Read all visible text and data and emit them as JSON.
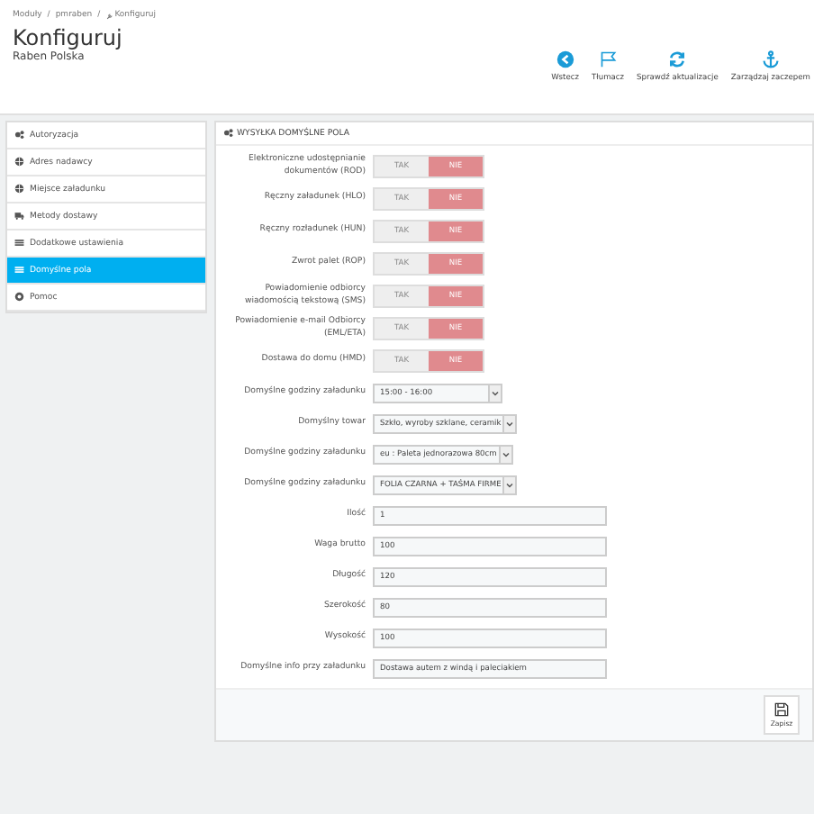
{
  "breadcrumb": [
    {
      "kind": "link",
      "text": "Moduły"
    },
    {
      "kind": "separator",
      "text": "/"
    },
    {
      "kind": "link",
      "text": "pmraben"
    },
    {
      "kind": "separator",
      "text": "/"
    },
    {
      "kind": "current",
      "text": "Konfiguruj"
    }
  ],
  "page_title": "Konfiguruj",
  "page_subtitle": "Raben Polska",
  "toolbar": [
    {
      "label": "Wstecz"
    },
    {
      "label": "Tłumacz"
    },
    {
      "label": "Sprawdź aktualizacje"
    },
    {
      "label": "Zarządzaj zaczepem"
    }
  ],
  "sidebar": {
    "items": [
      {
        "label": "Autoryzacja",
        "selected": false
      },
      {
        "label": "Adres nadawcy",
        "selected": false
      },
      {
        "label": "Miejsce załadunku",
        "selected": false
      },
      {
        "label": "Metody dostawy",
        "selected": false
      },
      {
        "label": "Dodatkowe ustawienia",
        "selected": false
      },
      {
        "label": "Domyślne pola",
        "selected": true
      },
      {
        "label": "Pomoc",
        "selected": false
      }
    ]
  },
  "panel": {
    "title": "WYSYŁKA DOMYŚLNE POLA",
    "fields": [
      {
        "kind": "toggle",
        "label": "Elektroniczne udostępnianie dokumentów (ROD)",
        "yes": "TAK",
        "no": "NIE",
        "on": false
      },
      {
        "kind": "toggle",
        "label": "Ręczny załadunek (HLO)",
        "yes": "TAK",
        "no": "NIE",
        "on": false
      },
      {
        "kind": "toggle",
        "label": "Ręczny rozładunek (HUN)",
        "yes": "TAK",
        "no": "NIE",
        "on": false
      },
      {
        "kind": "toggle",
        "label": "Zwrot palet (ROP)",
        "yes": "TAK",
        "no": "NIE",
        "on": false
      },
      {
        "kind": "toggle",
        "label": "Powiadomienie odbiorcy wiadomością tekstową (SMS)",
        "yes": "TAK",
        "no": "NIE",
        "on": false
      },
      {
        "kind": "toggle",
        "label": "Powiadomienie e-mail Odbiorcy (EML/ETA)",
        "yes": "TAK",
        "no": "NIE",
        "on": false
      },
      {
        "kind": "toggle",
        "label": "Dostawa do domu (HMD)",
        "yes": "TAK",
        "no": "NIE",
        "on": false
      },
      {
        "kind": "select",
        "label": "Domyślne godziny załadunku",
        "value": "15:00 - 16:00"
      },
      {
        "kind": "select",
        "label": "Domyślny towar",
        "value": "Szkło, wyroby szklane, ceramik"
      },
      {
        "kind": "select",
        "label": "Domyślne godziny załadunku",
        "value": "eu : Paleta jednorazowa 80cm"
      },
      {
        "kind": "select",
        "label": "Domyślne godziny załadunku",
        "value": "FOLIA CZARNA + TAŚMA FIRME"
      },
      {
        "kind": "input",
        "label": "Ilość",
        "value": "1"
      },
      {
        "kind": "input",
        "label": "Waga brutto",
        "value": "100"
      },
      {
        "kind": "input",
        "label": "Długość",
        "value": "120"
      },
      {
        "kind": "input",
        "label": "Szerokość",
        "value": "80"
      },
      {
        "kind": "input",
        "label": "Wysokość",
        "value": "100"
      },
      {
        "kind": "input",
        "label": "Domyślne info przy załadunku",
        "value": "Dostawa autem z windą i paleciakiem"
      }
    ],
    "save_label": "Zapisz"
  }
}
